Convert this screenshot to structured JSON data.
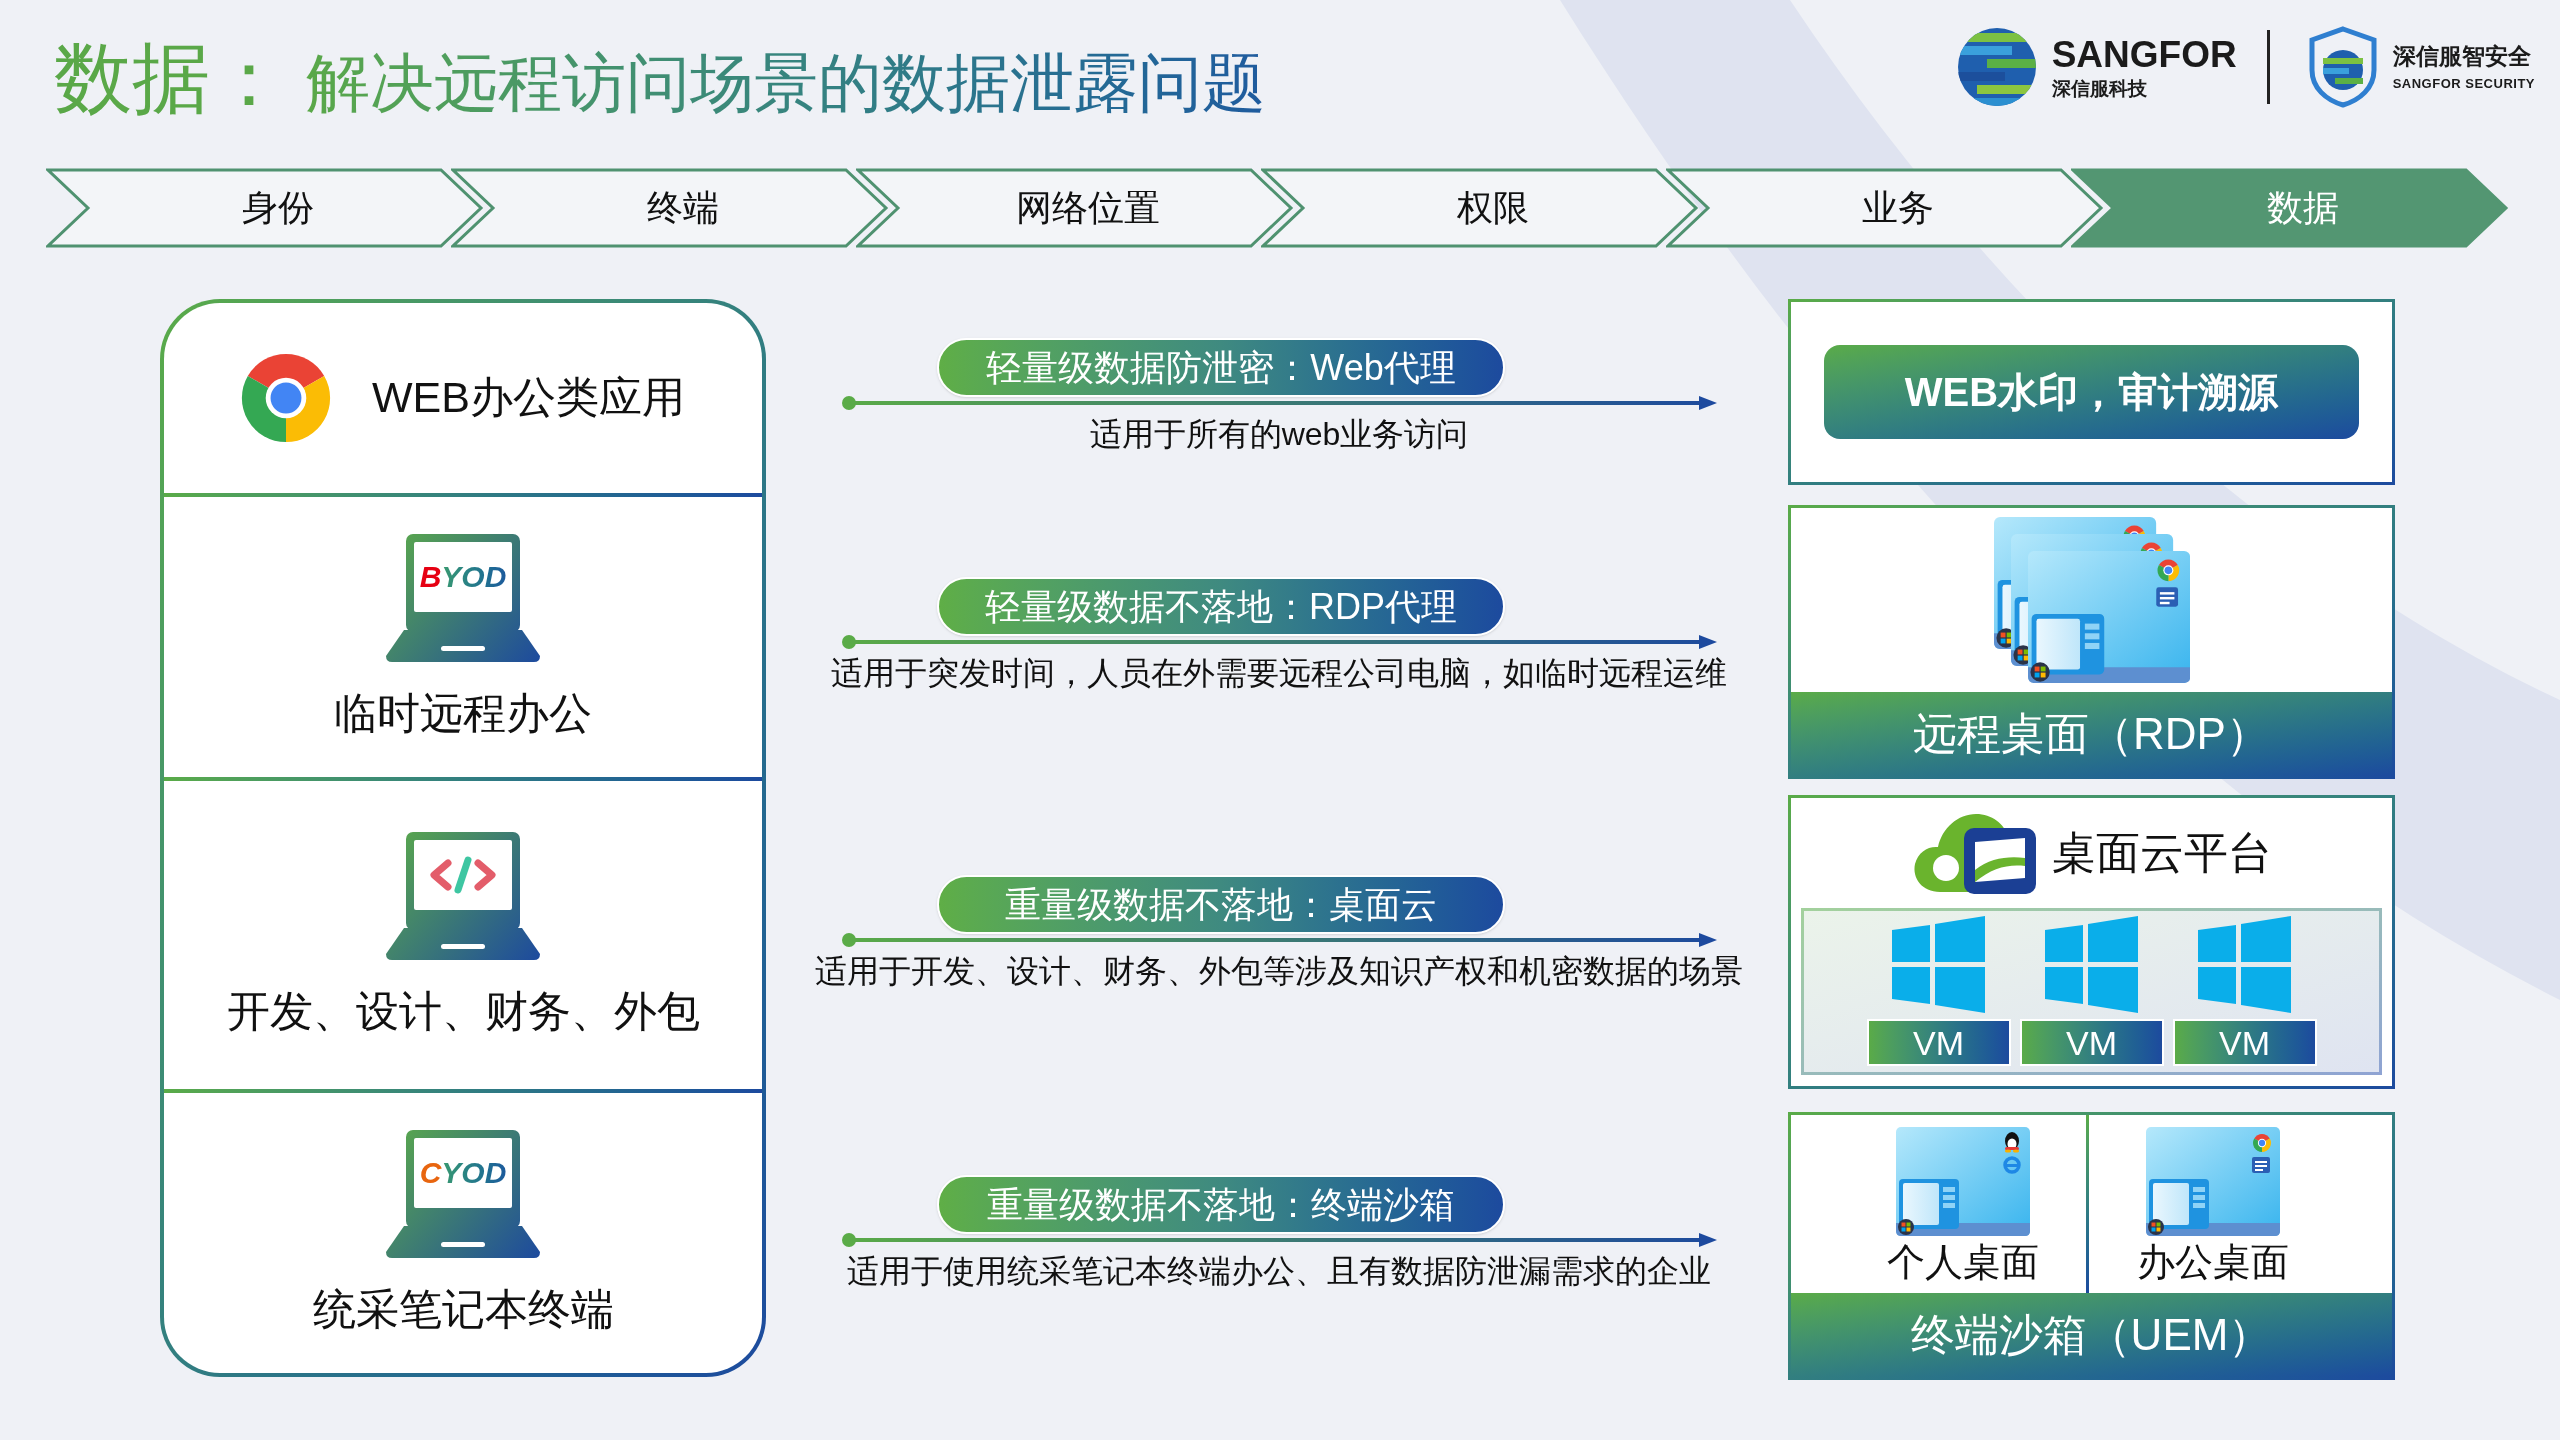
{
  "title": {
    "lead": "数据：",
    "text": "解决远程访问场景的数据泄露问题"
  },
  "logos": [
    {
      "kind": "globe",
      "name": "SANGFOR",
      "tagline": "深信服科技"
    },
    {
      "kind": "shield",
      "name": "深信服智安全",
      "tagline": "SANGFOR SECURITY"
    }
  ],
  "steps": [
    {
      "label": "身份",
      "selected": false
    },
    {
      "label": "终端",
      "selected": false
    },
    {
      "label": "网络位置",
      "selected": false
    },
    {
      "label": "权限",
      "selected": false
    },
    {
      "label": "业务",
      "selected": false
    },
    {
      "label": "数据",
      "selected": true
    }
  ],
  "scenarios": [
    {
      "kind": "browser",
      "label": "WEB办公类应用"
    },
    {
      "kind": "laptop_text",
      "screen": {
        "accent": "B",
        "rest": "YOD",
        "color": "#e60012"
      },
      "label": "临时远程办公"
    },
    {
      "kind": "laptop_code",
      "label": "开发、设计、财务、外包"
    },
    {
      "kind": "laptop_text",
      "screen": {
        "accent": "C",
        "rest": "YOD",
        "color": "#e8650f"
      },
      "label": "统采笔记本终端"
    }
  ],
  "channels": [
    {
      "label": "轻量级数据防泄密：Web代理",
      "note": "适用于所有的web业务访问"
    },
    {
      "label": "轻量级数据不落地：RDP代理",
      "note": "适用于突发时间，人员在外需要远程公司电脑，如临时远程运维"
    },
    {
      "label": "重量级数据不落地：桌面云",
      "note": "适用于开发、设计、财务、外包等涉及知识产权和机密数据的场景"
    },
    {
      "label": "重量级数据不落地：终端沙箱",
      "note": "适用于使用统采笔记本终端办公、且有数据防泄漏需求的企业"
    }
  ],
  "solutions": [
    {
      "kind": "banner",
      "label": "WEB水印，审计溯源"
    },
    {
      "kind": "remote_desktop",
      "footer": "远程桌面（RDP）"
    },
    {
      "kind": "cloud",
      "title": "桌面云平台",
      "vms": [
        "VM",
        "VM",
        "VM"
      ]
    },
    {
      "kind": "sandbox",
      "desktops": [
        {
          "kind": "personal",
          "label": "个人桌面"
        },
        {
          "kind": "office",
          "label": "办公桌面"
        }
      ],
      "footer": "终端沙箱（UEM）"
    }
  ]
}
